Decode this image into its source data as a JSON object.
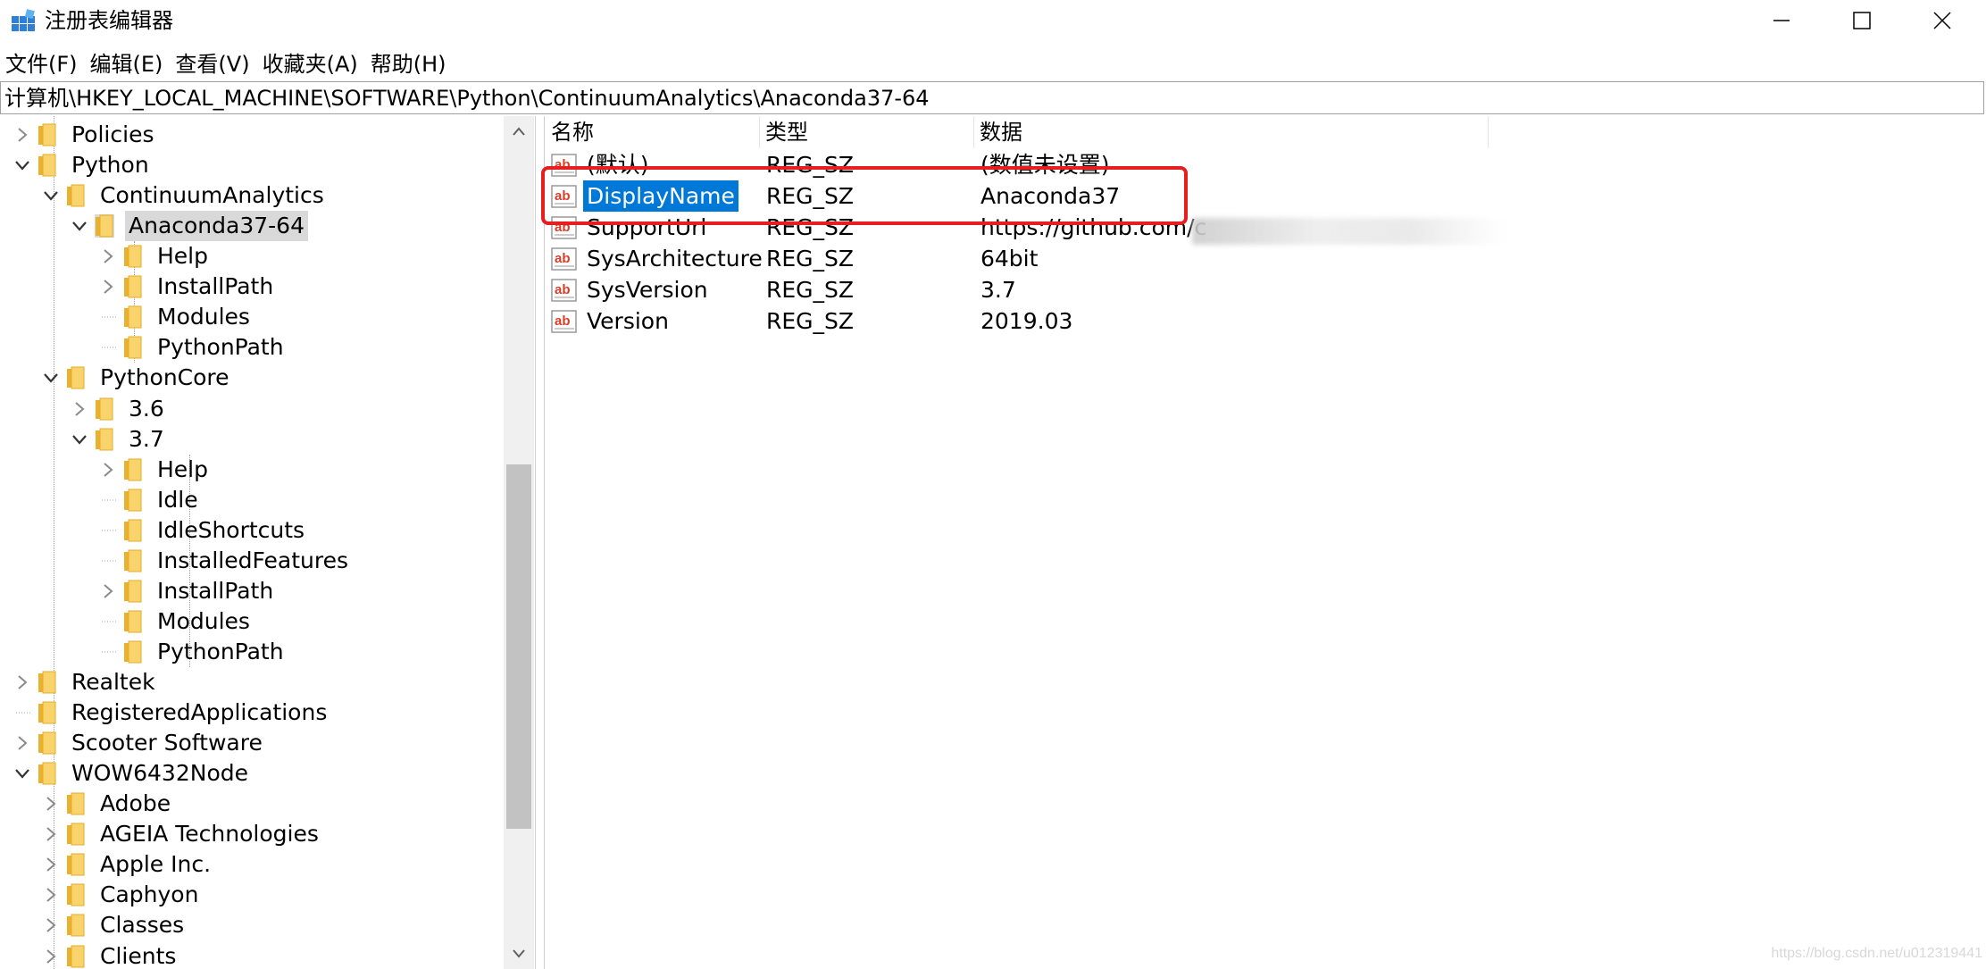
{
  "window": {
    "title": "注册表编辑器",
    "icons": {
      "app": "registry-editor-icon",
      "minimize": "minimize-icon",
      "maximize": "maximize-icon",
      "close": "close-icon"
    }
  },
  "menu": [
    "文件(F)",
    "编辑(E)",
    "查看(V)",
    "收藏夹(A)",
    "帮助(H)"
  ],
  "address": "计算机\\HKEY_LOCAL_MACHINE\\SOFTWARE\\Python\\ContinuumAnalytics\\Anaconda37-64",
  "tree": [
    {
      "label": "Policies",
      "expand": "collapsed"
    },
    {
      "label": "Python",
      "expand": "expanded"
    },
    {
      "label": "ContinuumAnalytics",
      "expand": "expanded"
    },
    {
      "label": "Anaconda37-64",
      "expand": "expanded",
      "selected": true
    },
    {
      "label": "Help",
      "expand": "collapsed"
    },
    {
      "label": "InstallPath",
      "expand": "collapsed"
    },
    {
      "label": "Modules",
      "expand": "none"
    },
    {
      "label": "PythonPath",
      "expand": "none"
    },
    {
      "label": "PythonCore",
      "expand": "expanded"
    },
    {
      "label": "3.6",
      "expand": "collapsed"
    },
    {
      "label": "3.7",
      "expand": "expanded"
    },
    {
      "label": "Help",
      "expand": "collapsed"
    },
    {
      "label": "Idle",
      "expand": "none"
    },
    {
      "label": "IdleShortcuts",
      "expand": "none"
    },
    {
      "label": "InstalledFeatures",
      "expand": "none"
    },
    {
      "label": "InstallPath",
      "expand": "collapsed"
    },
    {
      "label": "Modules",
      "expand": "none"
    },
    {
      "label": "PythonPath",
      "expand": "none"
    },
    {
      "label": "Realtek",
      "expand": "collapsed"
    },
    {
      "label": "RegisteredApplications",
      "expand": "none"
    },
    {
      "label": "Scooter Software",
      "expand": "collapsed"
    },
    {
      "label": "WOW6432Node",
      "expand": "expanded"
    },
    {
      "label": "Adobe",
      "expand": "collapsed"
    },
    {
      "label": "AGEIA Technologies",
      "expand": "collapsed"
    },
    {
      "label": "Apple Inc.",
      "expand": "collapsed"
    },
    {
      "label": "Caphyon",
      "expand": "collapsed"
    },
    {
      "label": "Classes",
      "expand": "collapsed"
    },
    {
      "label": "Clients",
      "expand": "collapsed"
    }
  ],
  "columns": {
    "name": "名称",
    "type": "类型",
    "data": "数据"
  },
  "values": [
    {
      "name": "(默认)",
      "type": "REG_SZ",
      "data": "(数值未设置)"
    },
    {
      "name": "DisplayName",
      "type": "REG_SZ",
      "data": "Anaconda37",
      "selected": true
    },
    {
      "name": "SupportUrl",
      "type": "REG_SZ",
      "data": "https://github.com/c"
    },
    {
      "name": "SysArchitecture",
      "type": "REG_SZ",
      "data": "64bit"
    },
    {
      "name": "SysVersion",
      "type": "REG_SZ",
      "data": "3.7"
    },
    {
      "name": "Version",
      "type": "REG_SZ",
      "data": "2019.03"
    }
  ],
  "colors": {
    "selection": "#0078d7",
    "highlight_box": "#e61e1e",
    "folder": "#f7c948",
    "tree_selected": "#d9d9d9"
  },
  "watermark": "https://blog.csdn.net/u012319441"
}
